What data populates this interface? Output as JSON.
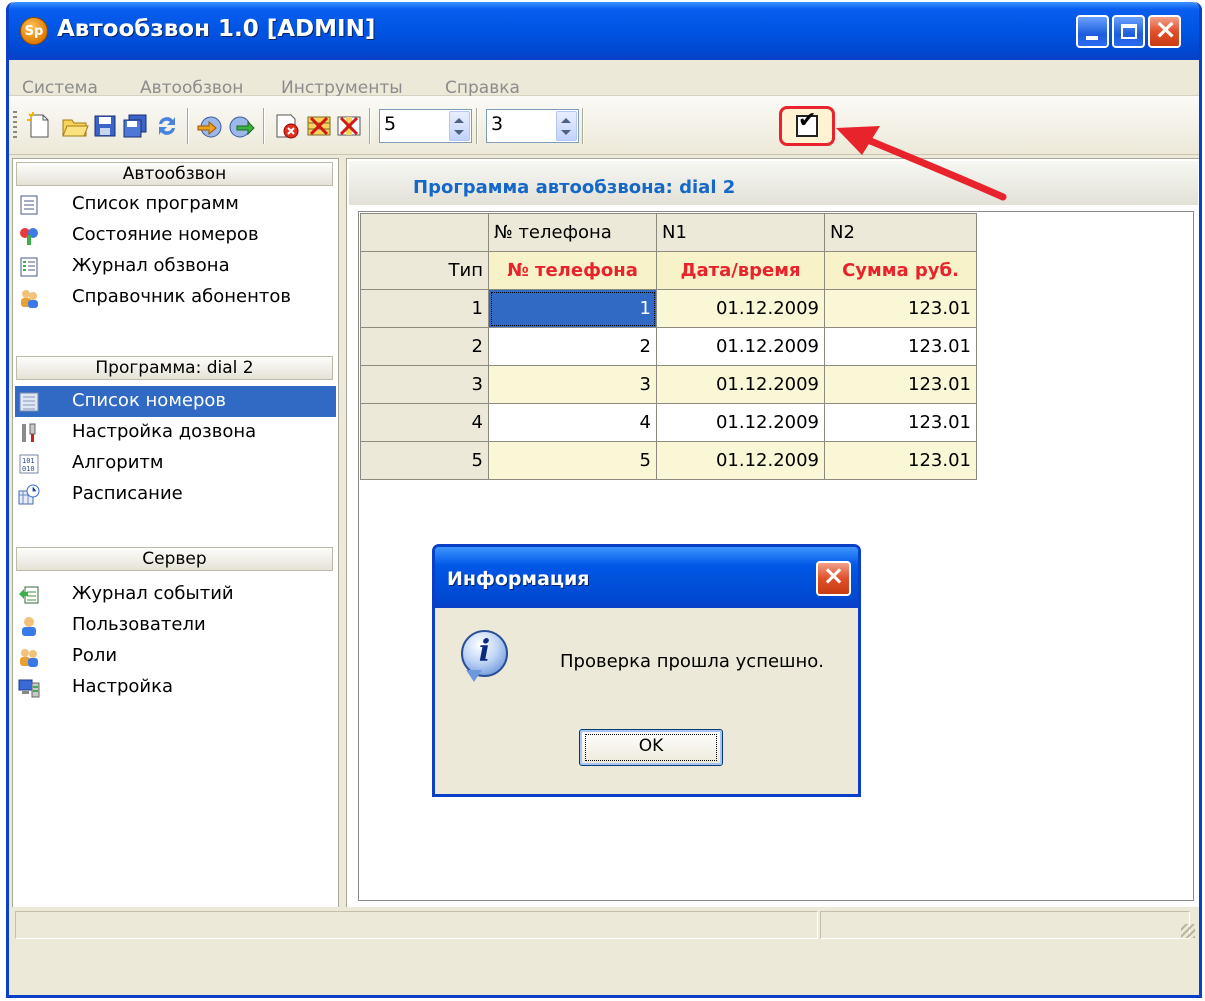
{
  "window": {
    "title": "Автообзвон 1.0 [ADMIN]",
    "logo_text": "Sp"
  },
  "menu": [
    "Система",
    "Автообзвон",
    "Инструменты",
    "Справка"
  ],
  "toolbar": {
    "spin1_value": "5",
    "spin2_value": "3",
    "check_glyph": "✔",
    "highlight_color": "#e8232b"
  },
  "sidebar": {
    "groups": [
      {
        "header": "Автообзвон",
        "items": [
          "Список программ",
          "Состояние номеров",
          "Журнал обзвона",
          "Справочник абонентов"
        ]
      },
      {
        "header": "Программа: dial 2",
        "items": [
          "Список номеров",
          "Настройка дозвона",
          "Алгоритм",
          "Расписание"
        ],
        "selected": 0
      },
      {
        "header": "Сервер",
        "items": [
          "Журнал событий",
          "Пользователи",
          "Роли",
          "Настройка"
        ]
      }
    ]
  },
  "main": {
    "program_title": "Программа автообзвона: dial 2",
    "grid": {
      "header_row": [
        "",
        "№ телефона",
        "N1",
        "N2"
      ],
      "type_row": [
        "Тип",
        "№ телефона",
        "Дата/время",
        "Сумма руб."
      ],
      "rows": [
        [
          "1",
          "1",
          "01.12.2009",
          "123.01"
        ],
        [
          "2",
          "2",
          "01.12.2009",
          "123.01"
        ],
        [
          "3",
          "3",
          "01.12.2009",
          "123.01"
        ],
        [
          "4",
          "4",
          "01.12.2009",
          "123.01"
        ],
        [
          "5",
          "5",
          "01.12.2009",
          "123.01"
        ]
      ]
    }
  },
  "dialog": {
    "title": "Информация",
    "message": "Проверка прошла успешно.",
    "ok_label": "OK",
    "icon": "info-icon"
  },
  "colors": {
    "accent": "#1468c8",
    "selection": "#316ac5",
    "annotation_arrow": "#e8232b"
  }
}
